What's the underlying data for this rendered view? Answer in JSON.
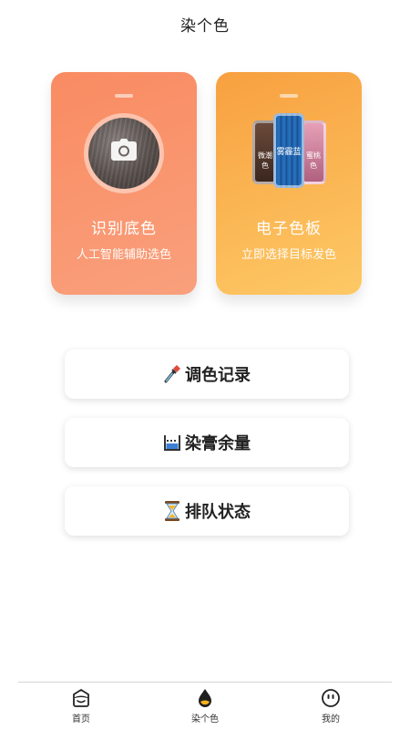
{
  "header": {
    "title": "染个色"
  },
  "cards": {
    "left": {
      "title": "识别底色",
      "subtitle": "人工智能辅助选色",
      "icon": "camera-icon"
    },
    "right": {
      "title": "电子色板",
      "subtitle": "立即选择目标发色",
      "swatches": {
        "left": "微潮色",
        "middle": "雾霾蓝",
        "right": "蜜桃色"
      }
    }
  },
  "buttons": {
    "record": {
      "label": "调色记录",
      "icon": "dropper-icon"
    },
    "stock": {
      "label": "染膏余量",
      "icon": "beaker-icon"
    },
    "queue": {
      "label": "排队状态",
      "icon": "hourglass-icon"
    }
  },
  "tabbar": {
    "home": {
      "label": "首页",
      "icon": "home-icon"
    },
    "dye": {
      "label": "染个色",
      "icon": "dye-drop-icon"
    },
    "me": {
      "label": "我的",
      "icon": "profile-face-icon"
    }
  },
  "colors": {
    "card_left": "#f98b62",
    "card_right": "#fdb84f",
    "swatch_blue": "#1d5ea8"
  }
}
